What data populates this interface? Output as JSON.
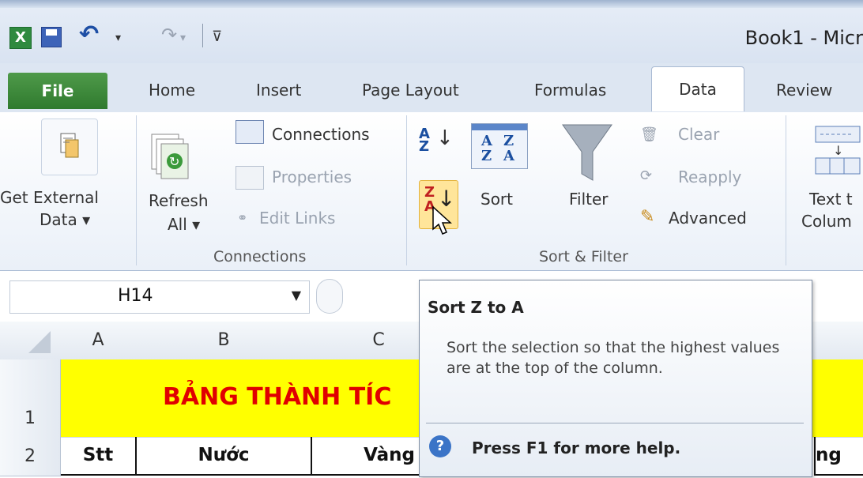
{
  "window": {
    "title": "Book1 - Micr"
  },
  "quick_access": {
    "icons": [
      "excel-logo",
      "save",
      "undo",
      "redo",
      "customize"
    ]
  },
  "tabs": [
    "File",
    "Home",
    "Insert",
    "Page Layout",
    "Formulas",
    "Data",
    "Review"
  ],
  "active_tab": "Data",
  "ribbon": {
    "get_external": {
      "line1": "Get External",
      "line2": "Data ▾"
    },
    "refresh": {
      "line1": "Refresh",
      "line2": "All ▾"
    },
    "connections": {
      "connections": "Connections",
      "properties": "Properties",
      "edit_links": "Edit Links",
      "group_label": "Connections"
    },
    "sort_filter": {
      "sort": "Sort",
      "filter": "Filter",
      "clear": "Clear",
      "reapply": "Reapply",
      "advanced": "Advanced",
      "group_label": "Sort & Filter"
    },
    "text_to_columns": {
      "line1": "Text t",
      "line2": "Colum"
    }
  },
  "formula_bar": {
    "name_box": "H14"
  },
  "grid": {
    "columns": [
      "A",
      "B",
      "C"
    ],
    "rows": [
      "1",
      "2"
    ],
    "title_text": "BẢNG THÀNH TÍC",
    "headers": [
      "Stt",
      "Nước",
      "Vàng"
    ],
    "partial_right_header": "ng"
  },
  "tooltip": {
    "title": "Sort Z to A",
    "description": "Sort the selection so that the highest values are at the top of the column.",
    "help": "Press F1 for more help."
  }
}
